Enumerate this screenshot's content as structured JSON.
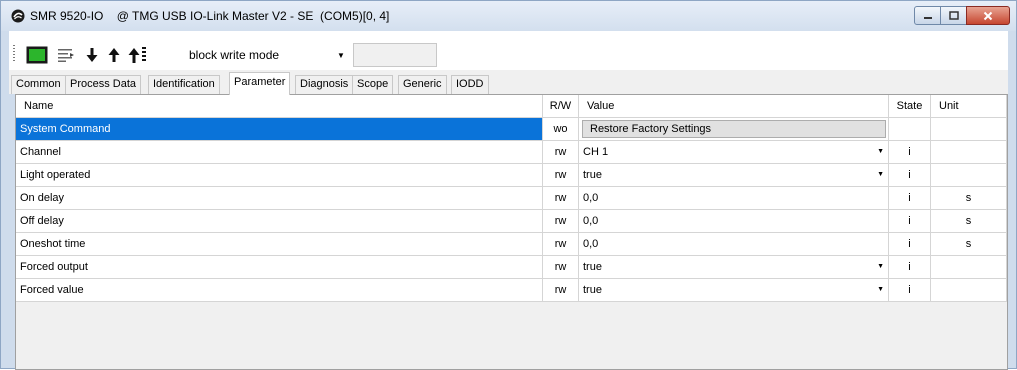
{
  "window": {
    "title": "SMR 9520-IO    @ TMG USB IO-Link Master V2 - SE  (COM5)[0, 4]"
  },
  "toolbar": {
    "mode_value": "block write mode",
    "buttons": [
      "connect-status",
      "list",
      "read-down",
      "write-up",
      "write-all-up"
    ]
  },
  "tabs": [
    {
      "label": "Common",
      "active": false
    },
    {
      "label": "Process Data",
      "active": false
    },
    {
      "label": "Identification",
      "active": false
    },
    {
      "label": "Parameter",
      "active": true
    },
    {
      "label": "Diagnosis",
      "active": false
    },
    {
      "label": "Scope",
      "active": false
    },
    {
      "label": "Generic",
      "active": false
    },
    {
      "label": "IODD",
      "active": false
    }
  ],
  "grid": {
    "headers": {
      "name": "Name",
      "rw": "R/W",
      "value": "Value",
      "state": "State",
      "unit": "Unit"
    },
    "rows": [
      {
        "name": "System Command",
        "rw": "wo",
        "value": "Restore Factory Settings",
        "state": "",
        "unit": "",
        "kind": "button"
      },
      {
        "name": "Channel",
        "rw": "rw",
        "value": "CH 1",
        "state": "i",
        "unit": "",
        "kind": "dropdown"
      },
      {
        "name": "Light operated",
        "rw": "rw",
        "value": "true",
        "state": "i",
        "unit": "",
        "kind": "dropdown"
      },
      {
        "name": "On delay",
        "rw": "rw",
        "value": "0,0",
        "state": "i",
        "unit": "s",
        "kind": "text"
      },
      {
        "name": "Off delay",
        "rw": "rw",
        "value": "0,0",
        "state": "i",
        "unit": "s",
        "kind": "text"
      },
      {
        "name": "Oneshot time",
        "rw": "rw",
        "value": "0,0",
        "state": "i",
        "unit": "s",
        "kind": "text"
      },
      {
        "name": "Forced output",
        "rw": "rw",
        "value": "true",
        "state": "i",
        "unit": "",
        "kind": "dropdown"
      },
      {
        "name": "Forced value",
        "rw": "rw",
        "value": "true",
        "state": "i",
        "unit": "",
        "kind": "dropdown"
      }
    ]
  },
  "colors": {
    "selection": "#0a73d9",
    "status_green": "#1fa51f"
  }
}
